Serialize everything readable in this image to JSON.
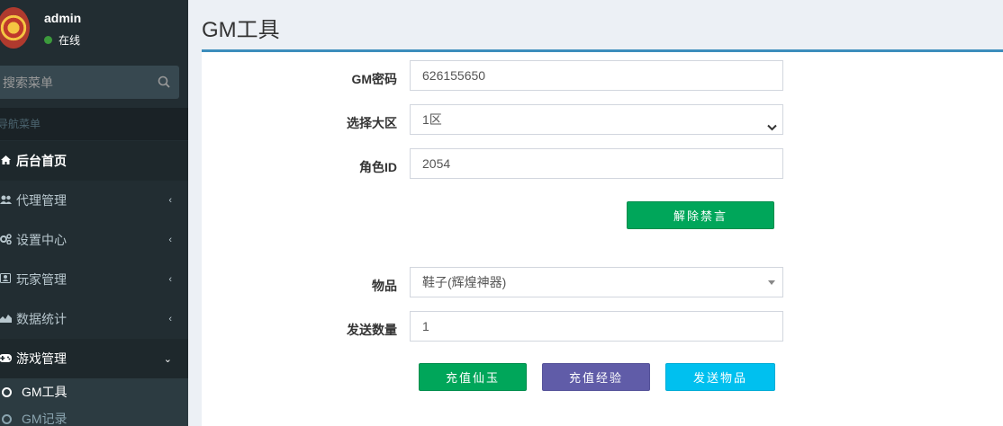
{
  "sidebar": {
    "user": {
      "name": "admin",
      "status": "在线"
    },
    "search": {
      "placeholder": "搜索菜单"
    },
    "nav_header": "导航菜单",
    "items": [
      {
        "label": "后台首页",
        "icon": "home-icon"
      },
      {
        "label": "代理管理",
        "icon": "users-icon"
      },
      {
        "label": "设置中心",
        "icon": "settings-icon"
      },
      {
        "label": "玩家管理",
        "icon": "player-icon"
      },
      {
        "label": "数据统计",
        "icon": "chart-icon"
      },
      {
        "label": "游戏管理",
        "icon": "gamepad-icon"
      }
    ],
    "subitems": [
      {
        "label": "GM工具"
      },
      {
        "label": "GM记录"
      }
    ]
  },
  "main": {
    "title": "GM工具",
    "form": {
      "gm_password": {
        "label": "GM密码",
        "value": "626155650"
      },
      "region": {
        "label": "选择大区",
        "value": "1区"
      },
      "role_id": {
        "label": "角色ID",
        "value": "2054"
      },
      "unban_button": "解除禁言",
      "item": {
        "label": "物品",
        "value": "鞋子(辉煌神器)"
      },
      "quantity": {
        "label": "发送数量",
        "value": "1"
      },
      "recharge_jade_button": "充值仙玉",
      "recharge_exp_button": "充值经验",
      "send_item_button": "发送物品"
    }
  },
  "colors": {
    "sidebar_bg": "#222d32",
    "box_border": "#3c8dbc",
    "green": "#00a65a",
    "purple": "#605ca8",
    "cyan": "#00c0ef"
  }
}
